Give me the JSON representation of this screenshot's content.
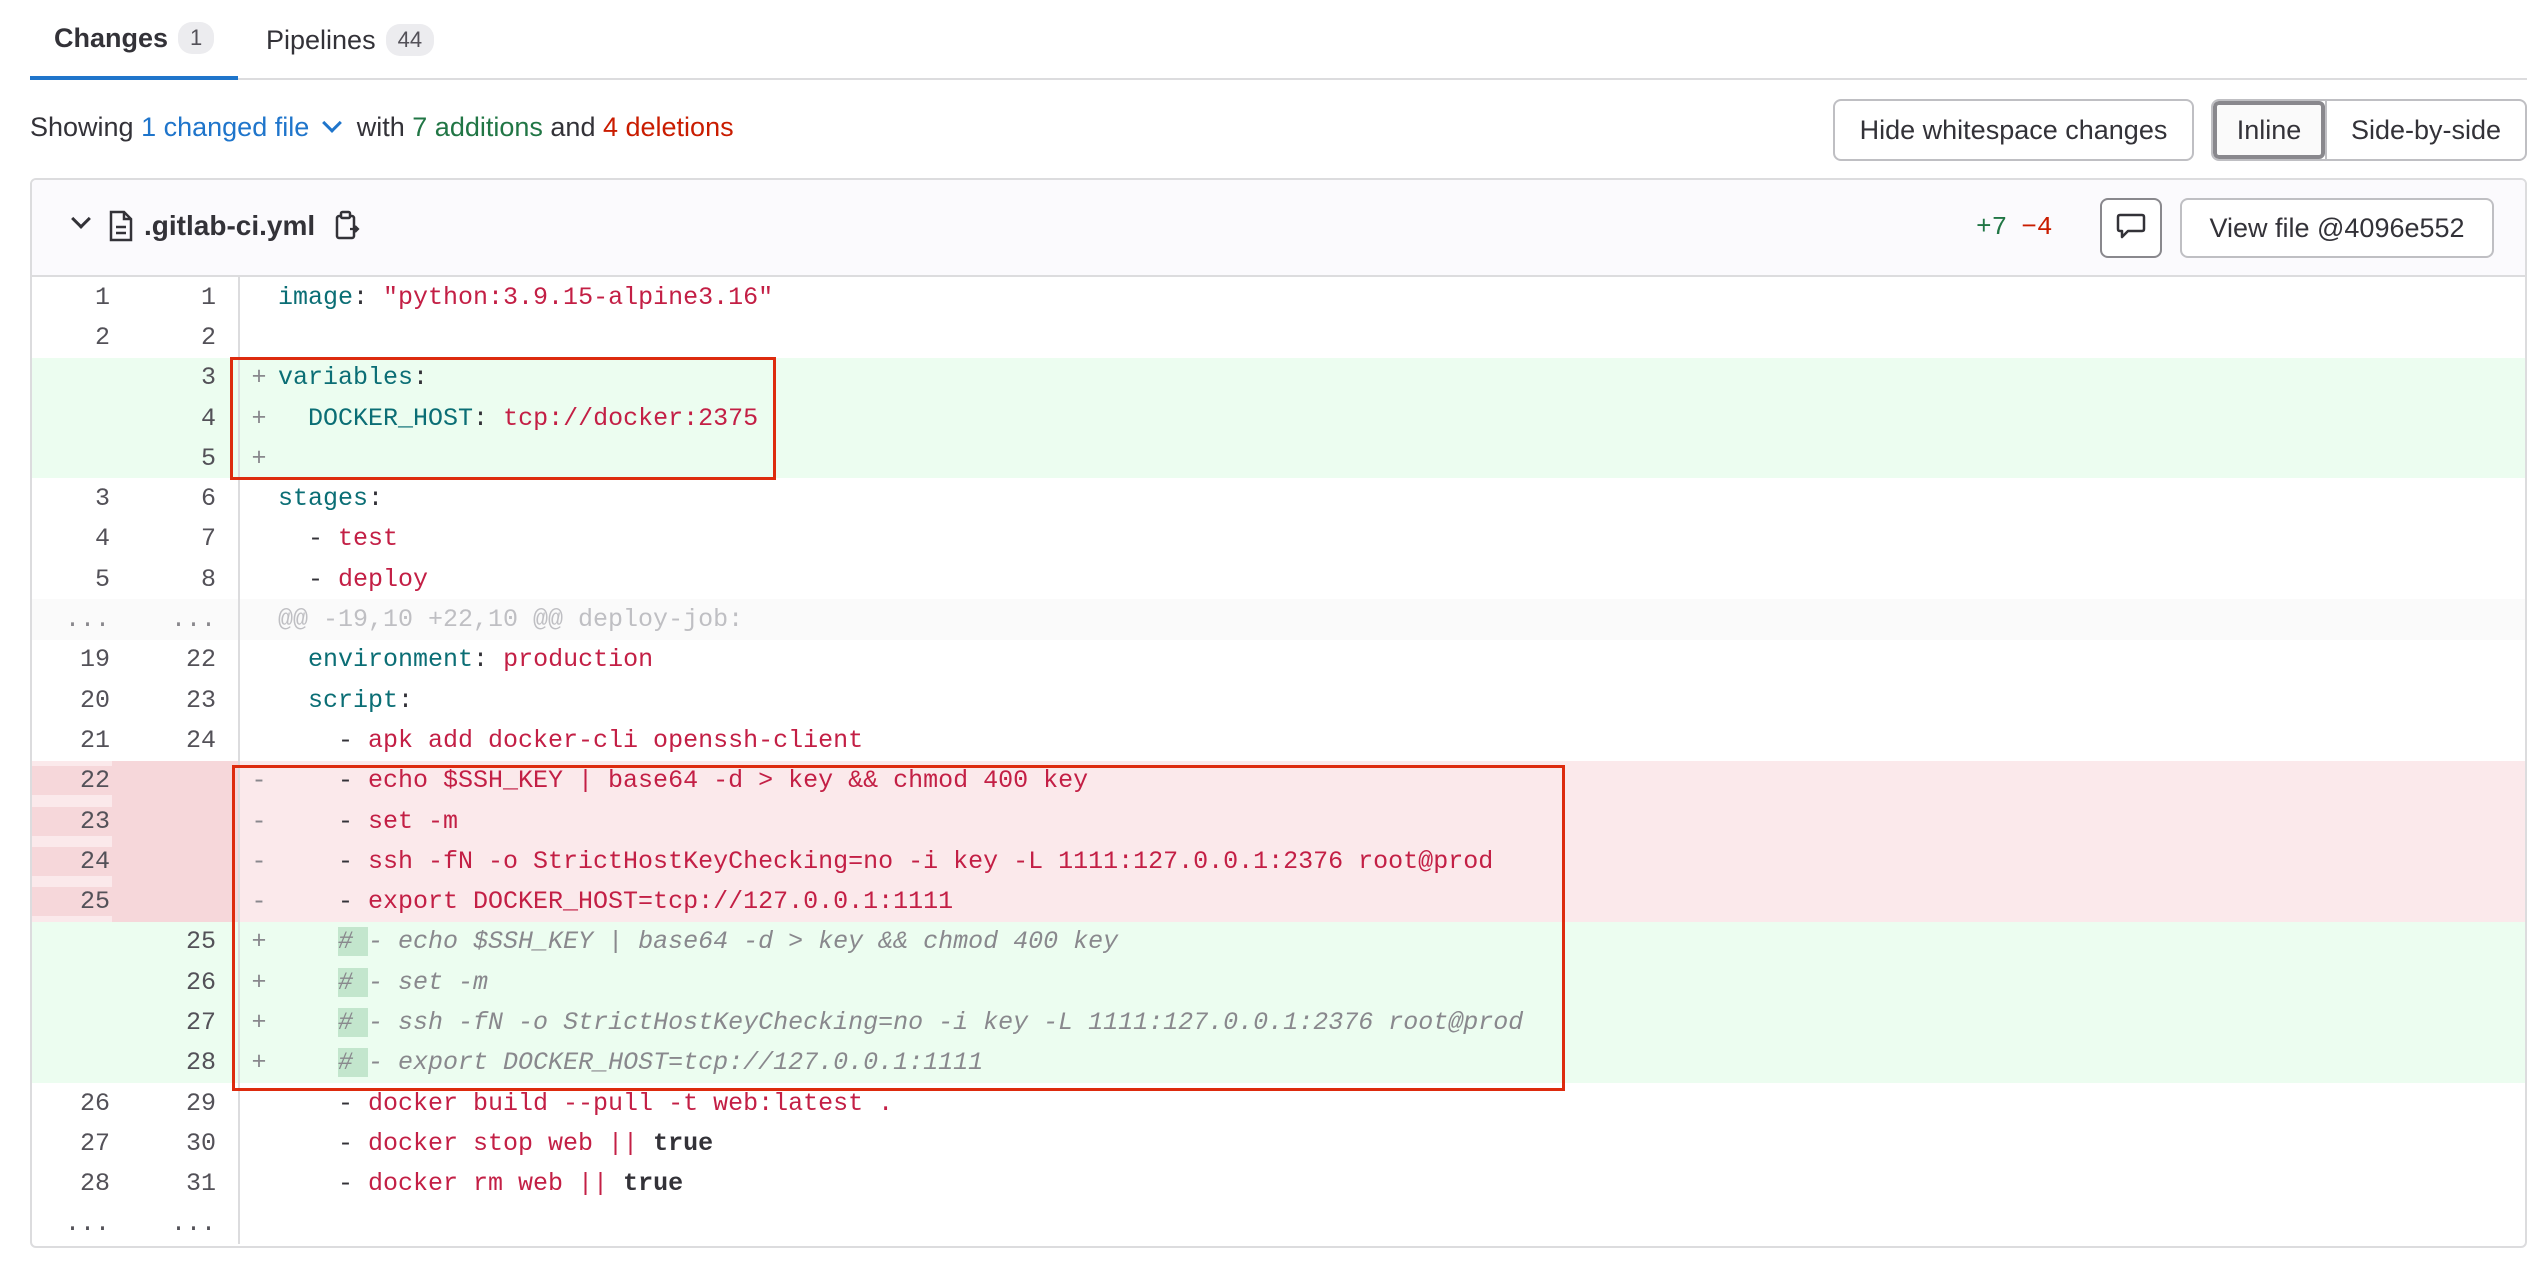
{
  "tabs": [
    {
      "label": "Changes",
      "count": "1"
    },
    {
      "label": "Pipelines",
      "count": "44"
    }
  ],
  "summary": {
    "prefix": "Showing",
    "changed": "1 changed file",
    "with": "with",
    "additions": "7 additions",
    "and": "and",
    "deletions": "4 deletions"
  },
  "toolbar": {
    "hide_whitespace": "Hide whitespace changes",
    "inline": "Inline",
    "side_by_side": "Side-by-side"
  },
  "file": {
    "name": ".gitlab-ci.yml",
    "added": "+7",
    "removed": "−4",
    "view_file": "View file @4096e552"
  },
  "diff_lines": [
    {
      "type": "ctx",
      "old": "1",
      "new": "1",
      "marker": "",
      "code": "image: \"python:3.9.15-alpine3.16\""
    },
    {
      "type": "ctx",
      "old": "2",
      "new": "2",
      "marker": "",
      "code": ""
    },
    {
      "type": "add",
      "old": "",
      "new": "3",
      "marker": "+",
      "code": "variables:"
    },
    {
      "type": "add",
      "old": "",
      "new": "4",
      "marker": "+",
      "code": "  DOCKER_HOST: tcp://docker:2375"
    },
    {
      "type": "add",
      "old": "",
      "new": "5",
      "marker": "+",
      "code": ""
    },
    {
      "type": "ctx",
      "old": "3",
      "new": "6",
      "marker": "",
      "code": "stages:"
    },
    {
      "type": "ctx",
      "old": "4",
      "new": "7",
      "marker": "",
      "code": "  - test"
    },
    {
      "type": "ctx",
      "old": "5",
      "new": "8",
      "marker": "",
      "code": "  - deploy"
    },
    {
      "type": "hunk",
      "old": "...",
      "new": "...",
      "marker": "",
      "code": "@@ -19,10 +22,10 @@ deploy-job:"
    },
    {
      "type": "ctx",
      "old": "19",
      "new": "22",
      "marker": "",
      "code": "  environment: production"
    },
    {
      "type": "ctx",
      "old": "20",
      "new": "23",
      "marker": "",
      "code": "  script:"
    },
    {
      "type": "ctx",
      "old": "21",
      "new": "24",
      "marker": "",
      "code": "    - apk add docker-cli openssh-client"
    },
    {
      "type": "del",
      "old": "22",
      "new": "",
      "marker": "-",
      "code": "    - echo $SSH_KEY | base64 -d > key && chmod 400 key"
    },
    {
      "type": "del",
      "old": "23",
      "new": "",
      "marker": "-",
      "code": "    - set -m"
    },
    {
      "type": "del",
      "old": "24",
      "new": "",
      "marker": "-",
      "code": "    - ssh -fN -o StrictHostKeyChecking=no -i key -L 1111:127.0.0.1:2376 root@prod"
    },
    {
      "type": "del",
      "old": "25",
      "new": "",
      "marker": "-",
      "code": "    - export DOCKER_HOST=tcp://127.0.0.1:1111"
    },
    {
      "type": "add",
      "old": "",
      "new": "25",
      "marker": "+",
      "code": "    # - echo $SSH_KEY | base64 -d > key && chmod 400 key"
    },
    {
      "type": "add",
      "old": "",
      "new": "26",
      "marker": "+",
      "code": "    # - set -m"
    },
    {
      "type": "add",
      "old": "",
      "new": "27",
      "marker": "+",
      "code": "    # - ssh -fN -o StrictHostKeyChecking=no -i key -L 1111:127.0.0.1:2376 root@prod"
    },
    {
      "type": "add",
      "old": "",
      "new": "28",
      "marker": "+",
      "code": "    # - export DOCKER_HOST=tcp://127.0.0.1:1111"
    },
    {
      "type": "ctx",
      "old": "26",
      "new": "29",
      "marker": "",
      "code": "    - docker build --pull -t web:latest ."
    },
    {
      "type": "ctx",
      "old": "27",
      "new": "30",
      "marker": "",
      "code": "    - docker stop web || true"
    },
    {
      "type": "ctx",
      "old": "28",
      "new": "31",
      "marker": "",
      "code": "    - docker rm web || true"
    },
    {
      "type": "ctx",
      "old": "...",
      "new": "...",
      "marker": "",
      "code": ""
    }
  ],
  "colors": {
    "accent": "#1f75cb",
    "addition": "#217645",
    "deletion": "#c91c00",
    "highlight_box": "#dd2b0e"
  }
}
